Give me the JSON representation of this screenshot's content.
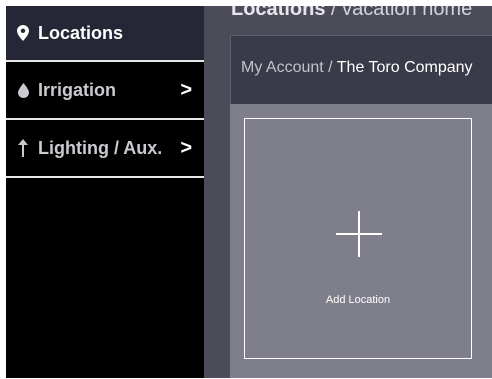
{
  "sidebar": {
    "items": [
      {
        "label": "Locations",
        "icon": "map-pin-icon",
        "active": true
      },
      {
        "label": "Irrigation",
        "icon": "water-drop-icon",
        "chevron": ">"
      },
      {
        "label": "Lighting / Aux.",
        "icon": "arrow-up-icon",
        "chevron": ">"
      }
    ]
  },
  "header": {
    "title": "Locations",
    "separator": "/",
    "subtitle": "vacation home"
  },
  "breadcrumb": {
    "root": "My Account",
    "separator": "/",
    "company": "The Toro Company"
  },
  "add_location": {
    "label": "Add Location"
  },
  "colors": {
    "sidebar_bg": "#000000",
    "active_item_bg": "#262736",
    "main_bg": "#4b4c58",
    "card_bg": "#7e7f8b"
  }
}
